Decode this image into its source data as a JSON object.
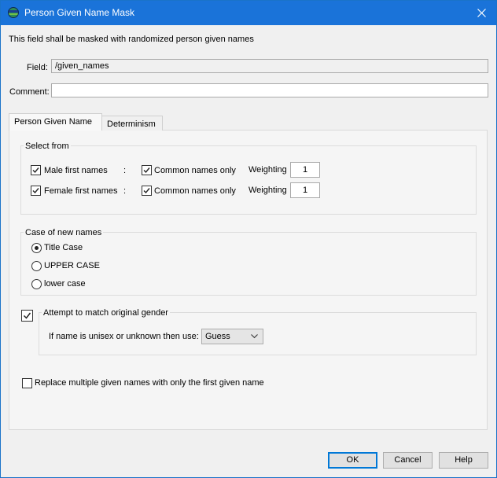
{
  "window": {
    "title": "Person Given Name Mask"
  },
  "description": "This field shall be masked with randomized person given names",
  "field": {
    "label": "Field:",
    "value": "/given_names"
  },
  "comment": {
    "label": "Comment:",
    "value": ""
  },
  "tabs": [
    {
      "label": "Person Given Name",
      "active": true
    },
    {
      "label": "Determinism",
      "active": false
    }
  ],
  "select_from": {
    "title": "Select from",
    "rows": [
      {
        "label": "Male first names",
        "checked": true,
        "separator": ":",
        "common_label": "Common names only",
        "common_checked": true,
        "weighting_label": "Weighting",
        "weighting_value": "1"
      },
      {
        "label": "Female first names",
        "checked": true,
        "separator": ":",
        "common_label": "Common names only",
        "common_checked": true,
        "weighting_label": "Weighting",
        "weighting_value": "1"
      }
    ]
  },
  "case_group": {
    "title": "Case of new names",
    "options": [
      {
        "label": "Title Case",
        "selected": true
      },
      {
        "label": "UPPER CASE",
        "selected": false
      },
      {
        "label": "lower case",
        "selected": false
      }
    ]
  },
  "gender": {
    "label": "Attempt to match original gender",
    "checked": true,
    "unisex_label": "If name is unisex or unknown then use:",
    "unisex_value": "Guess"
  },
  "replace_multiple": {
    "label": "Replace multiple given names with only the first given name",
    "checked": false
  },
  "buttons": {
    "ok": "OK",
    "cancel": "Cancel",
    "help": "Help"
  },
  "colors": {
    "titlebar": "#1a73d9",
    "accent": "#0078d7"
  }
}
